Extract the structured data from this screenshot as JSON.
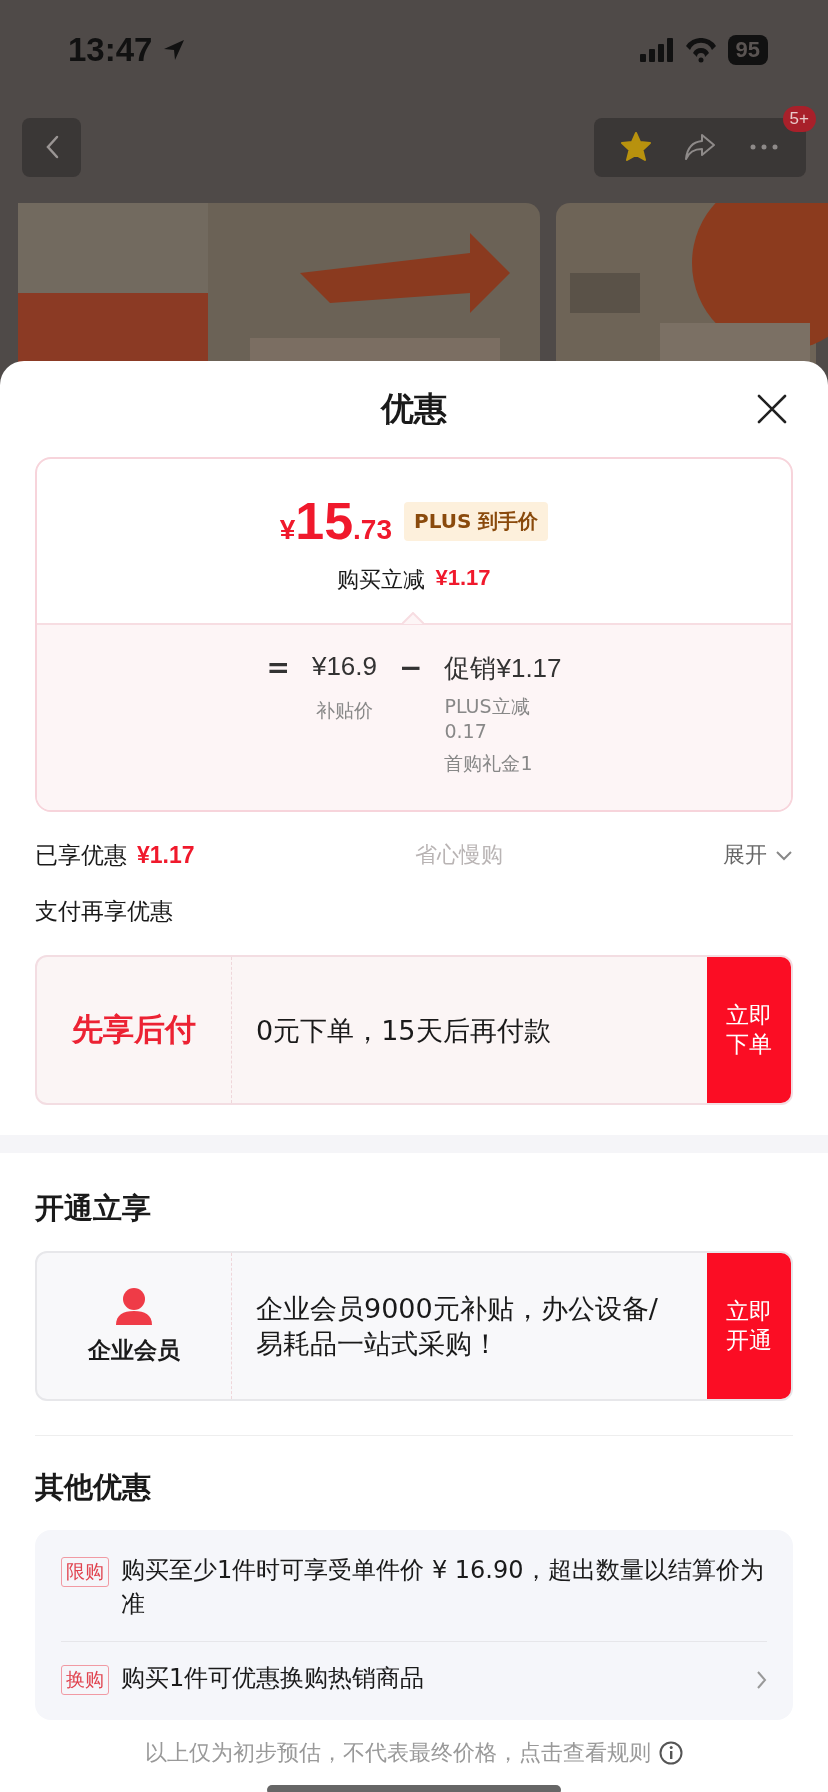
{
  "status_bar": {
    "time": "13:47",
    "battery": "95"
  },
  "nav": {
    "favorited": true,
    "badge": "5+"
  },
  "sheet": {
    "title": "优惠"
  },
  "price_card": {
    "symbol": "¥",
    "integer": "15",
    "decimal": ".73",
    "tag": "PLUS 到手价",
    "cut_label": "购买立减",
    "cut_amount": "¥1.17",
    "breakdown": {
      "equals": "=",
      "base_price": "¥16.9",
      "base_label": "补贴价",
      "minus": "−",
      "promo": "促销¥1.17",
      "promo_details": [
        "PLUS立减0.17",
        "首购礼金1"
      ]
    }
  },
  "savings": {
    "label": "已享优惠",
    "amount": "¥1.17",
    "slogan": "省心慢购",
    "expand": "展开"
  },
  "sections": [
    {
      "title": "支付再享优惠",
      "offer": {
        "kind": "text",
        "name": "先享后付",
        "desc": "0元下单，15天后再付款",
        "button": "立即下单"
      }
    },
    {
      "title": "开通立享",
      "offer": {
        "kind": "icon",
        "name": "企业会员",
        "desc": "企业会员9000元补贴，办公设备/易耗品一站式采购！",
        "button": "立即开通"
      }
    }
  ],
  "other": {
    "title": "其他优惠",
    "items": [
      {
        "tag": "限购",
        "text": "购买至少1件时可享受单件价 ¥ 16.90，超出数量以结算价为准",
        "arrow": false
      },
      {
        "tag": "换购",
        "text": "购买1件可优惠换购热销商品",
        "arrow": true
      }
    ]
  },
  "footer": {
    "note": "以上仅为初步预估，不代表最终价格，点击查看规则"
  }
}
